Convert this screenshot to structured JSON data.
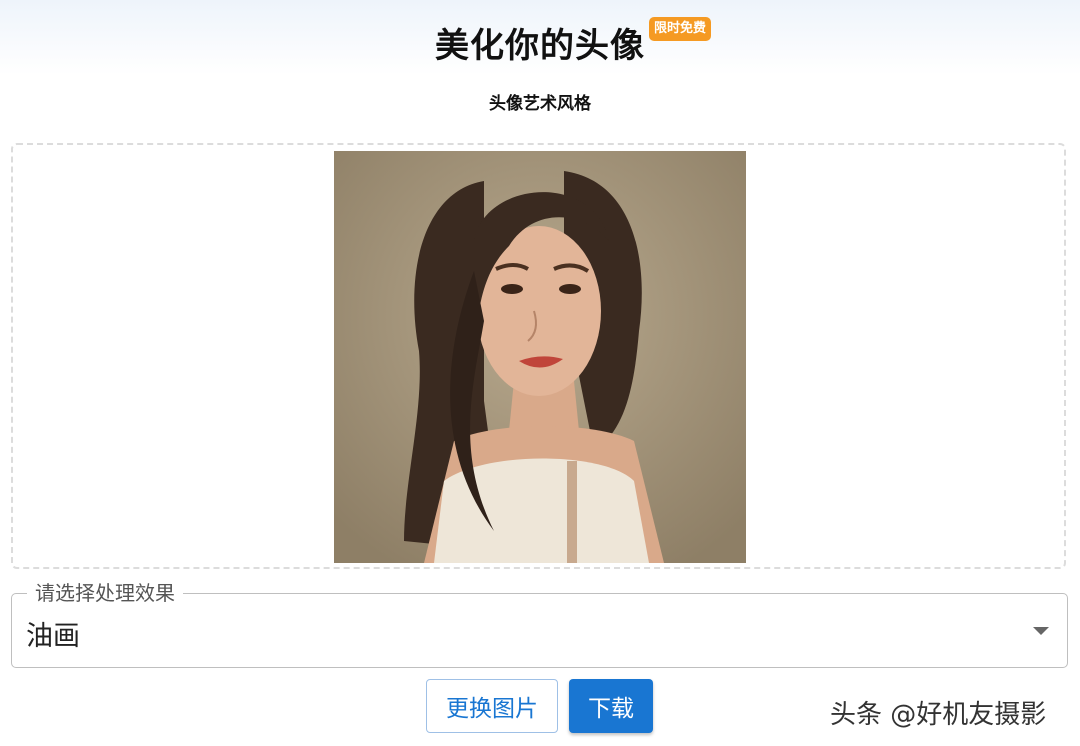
{
  "header": {
    "title": "美化你的头像",
    "badge": "限时免费",
    "subtitle": "头像艺术风格"
  },
  "effect_select": {
    "label": "请选择处理效果",
    "value": "油画"
  },
  "buttons": {
    "replace_label": "更换图片",
    "download_label": "下载"
  },
  "watermark": "头条 @好机友摄影",
  "colors": {
    "primary": "#1976d2",
    "badge": "#f59a23"
  },
  "icons": {
    "dropdown": "caret-down-icon"
  }
}
